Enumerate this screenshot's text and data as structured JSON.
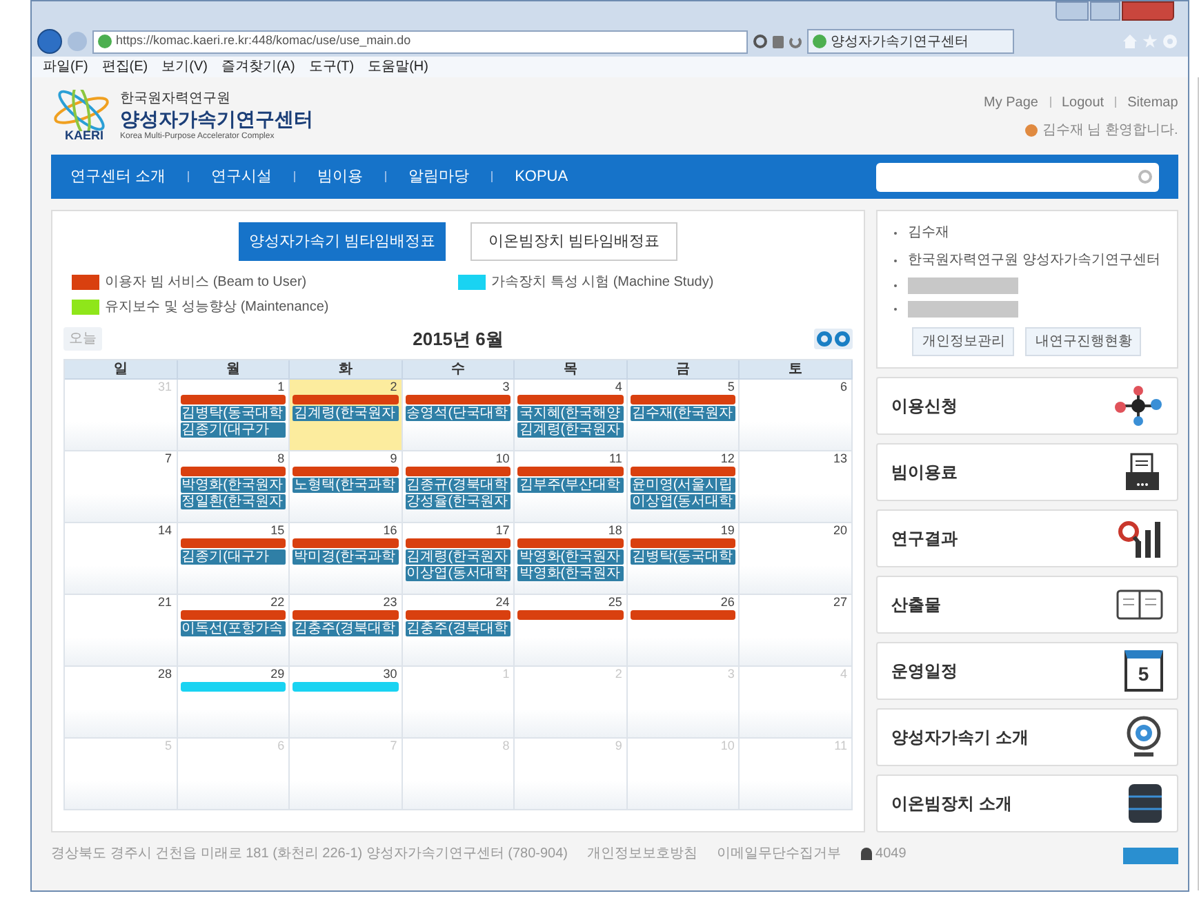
{
  "browser": {
    "url": "https://komac.kaeri.re.kr:448/komac/use/use_main.do",
    "tab_title": "양성자가속기연구센터",
    "menu": [
      "파일(F)",
      "편집(E)",
      "보기(V)",
      "즐겨찾기(A)",
      "도구(T)",
      "도움말(H)"
    ]
  },
  "header": {
    "logo_text": "KAERI",
    "org": "한국원자력연구원",
    "center": "양성자가속기연구센터",
    "subtitle": "Korea Multi-Purpose Accelerator Complex",
    "links": [
      "My Page",
      "Logout",
      "Sitemap"
    ],
    "welcome": "김수재 님 환영합니다."
  },
  "nav": {
    "items": [
      "연구센터 소개",
      "연구시설",
      "빔이용",
      "알림마당",
      "KOPUA"
    ]
  },
  "calendar_tabs": [
    {
      "label": "양성자가속기 빔타임배정표",
      "selected": true
    },
    {
      "label": "이온빔장치 빔타임배정표",
      "selected": false
    }
  ],
  "legend": [
    {
      "label": "이용자 빔 서비스 (Beam to User)",
      "color": "#d9400f"
    },
    {
      "label": "가속장치 특성 시험 (Machine Study)",
      "color": "#19d3f2"
    },
    {
      "label": "유지보수 및 성능향상 (Maintenance)",
      "color": "#8fe61a"
    }
  ],
  "calendar": {
    "today_button": "오늘",
    "title": "2015년 6월",
    "weekdays": [
      "일",
      "월",
      "화",
      "수",
      "목",
      "금",
      "토"
    ],
    "weeks": [
      [
        {
          "date": "31",
          "muted": true,
          "today": false
        },
        {
          "date": "1",
          "muted": false,
          "today": false,
          "bars": [
            {
              "color": "#d9400f"
            }
          ],
          "bookings": [
            "김병탁(동국대학",
            "김종기(대구가"
          ]
        },
        {
          "date": "2",
          "muted": false,
          "today": true,
          "bars": [
            {
              "color": "#d9400f"
            }
          ],
          "bookings": [
            "김계령(한국원자"
          ]
        },
        {
          "date": "3",
          "muted": false,
          "today": false,
          "bars": [
            {
              "color": "#d9400f"
            }
          ],
          "bookings": [
            "송영석(단국대학"
          ]
        },
        {
          "date": "4",
          "muted": false,
          "today": false,
          "bars": [
            {
              "color": "#d9400f"
            }
          ],
          "bookings": [
            "국지혜(한국해양",
            "김계령(한국원자"
          ]
        },
        {
          "date": "5",
          "muted": false,
          "today": false,
          "bars": [
            {
              "color": "#d9400f"
            }
          ],
          "bookings": [
            "김수재(한국원자"
          ]
        },
        {
          "date": "6",
          "muted": false,
          "today": false
        }
      ],
      [
        {
          "date": "7",
          "muted": false,
          "today": false
        },
        {
          "date": "8",
          "muted": false,
          "today": false,
          "bars": [
            {
              "color": "#d9400f"
            }
          ],
          "bookings": [
            "박영화(한국원자",
            "정일환(한국원자"
          ]
        },
        {
          "date": "9",
          "muted": false,
          "today": false,
          "bars": [
            {
              "color": "#d9400f"
            }
          ],
          "bookings": [
            "노형택(한국과학"
          ]
        },
        {
          "date": "10",
          "muted": false,
          "today": false,
          "bars": [
            {
              "color": "#d9400f"
            }
          ],
          "bookings": [
            "김종규(경북대학",
            "강성율(한국원자"
          ]
        },
        {
          "date": "11",
          "muted": false,
          "today": false,
          "bars": [
            {
              "color": "#d9400f"
            }
          ],
          "bookings": [
            "김부주(부산대학"
          ]
        },
        {
          "date": "12",
          "muted": false,
          "today": false,
          "bars": [
            {
              "color": "#d9400f"
            }
          ],
          "bookings": [
            "윤미영(서울시립",
            "이상엽(동서대학"
          ]
        },
        {
          "date": "13",
          "muted": false,
          "today": false
        }
      ],
      [
        {
          "date": "14",
          "muted": false,
          "today": false
        },
        {
          "date": "15",
          "muted": false,
          "today": false,
          "bars": [
            {
              "color": "#d9400f"
            }
          ],
          "bookings": [
            "김종기(대구가"
          ]
        },
        {
          "date": "16",
          "muted": false,
          "today": false,
          "bars": [
            {
              "color": "#d9400f"
            }
          ],
          "bookings": [
            "박미경(한국과학"
          ]
        },
        {
          "date": "17",
          "muted": false,
          "today": false,
          "bars": [
            {
              "color": "#d9400f"
            }
          ],
          "bookings": [
            "김계령(한국원자",
            "이상엽(동서대학"
          ]
        },
        {
          "date": "18",
          "muted": false,
          "today": false,
          "bars": [
            {
              "color": "#d9400f"
            }
          ],
          "bookings": [
            "박영화(한국원자",
            "박영화(한국원자"
          ]
        },
        {
          "date": "19",
          "muted": false,
          "today": false,
          "bars": [
            {
              "color": "#d9400f"
            }
          ],
          "bookings": [
            "김병탁(동국대학"
          ]
        },
        {
          "date": "20",
          "muted": false,
          "today": false
        }
      ],
      [
        {
          "date": "21",
          "muted": false,
          "today": false
        },
        {
          "date": "22",
          "muted": false,
          "today": false,
          "bars": [
            {
              "color": "#d9400f"
            }
          ],
          "bookings": [
            "이독선(포항가속"
          ]
        },
        {
          "date": "23",
          "muted": false,
          "today": false,
          "bars": [
            {
              "color": "#d9400f"
            }
          ],
          "bookings": [
            "김충주(경북대학"
          ]
        },
        {
          "date": "24",
          "muted": false,
          "today": false,
          "bars": [
            {
              "color": "#d9400f"
            }
          ],
          "bookings": [
            "김충주(경북대학"
          ]
        },
        {
          "date": "25",
          "muted": false,
          "today": false,
          "bars": [
            {
              "color": "#d9400f"
            }
          ]
        },
        {
          "date": "26",
          "muted": false,
          "today": false,
          "bars": [
            {
              "color": "#d9400f"
            }
          ]
        },
        {
          "date": "27",
          "muted": false,
          "today": false
        }
      ],
      [
        {
          "date": "28",
          "muted": false,
          "today": false
        },
        {
          "date": "29",
          "muted": false,
          "today": false,
          "bars": [
            {
              "color": "#19d3f2"
            }
          ]
        },
        {
          "date": "30",
          "muted": false,
          "today": false,
          "bars": [
            {
              "color": "#19d3f2"
            }
          ]
        },
        {
          "date": "1",
          "muted": true,
          "today": false
        },
        {
          "date": "2",
          "muted": true,
          "today": false
        },
        {
          "date": "3",
          "muted": true,
          "today": false
        },
        {
          "date": "4",
          "muted": true,
          "today": false
        }
      ],
      [
        {
          "date": "5",
          "muted": true,
          "today": false
        },
        {
          "date": "6",
          "muted": true,
          "today": false
        },
        {
          "date": "7",
          "muted": true,
          "today": false
        },
        {
          "date": "8",
          "muted": true,
          "today": false
        },
        {
          "date": "9",
          "muted": true,
          "today": false
        },
        {
          "date": "10",
          "muted": true,
          "today": false
        },
        {
          "date": "11",
          "muted": true,
          "today": false
        }
      ]
    ]
  },
  "profile": {
    "items": [
      {
        "kind": "text",
        "text": "김수재"
      },
      {
        "kind": "text",
        "text": "한국원자력연구원 양성자가속기연구센터"
      },
      {
        "kind": "redacted"
      },
      {
        "kind": "redacted"
      }
    ],
    "buttons": [
      "개인정보관리",
      "내연구진행현황"
    ]
  },
  "menu_cards": [
    {
      "label": "이용신청",
      "kind": "molecule"
    },
    {
      "label": "빔이용료",
      "kind": "printer"
    },
    {
      "label": "연구결과",
      "kind": "chart"
    },
    {
      "label": "산출물",
      "kind": "book"
    },
    {
      "label": "운영일정",
      "kind": "calendar",
      "icon_text": "5"
    },
    {
      "label": "양성자가속기 소개",
      "kind": "ring"
    },
    {
      "label": "이온빔장치 소개",
      "kind": "database"
    }
  ],
  "footer": {
    "address": "경상북도 경주시 건천읍 미래로 181 (화천리 226-1) 양성자가속기연구센터 (780-904)",
    "links": [
      "개인정보보호방침",
      "이메일무단수집거부"
    ],
    "visitors": "4049"
  }
}
